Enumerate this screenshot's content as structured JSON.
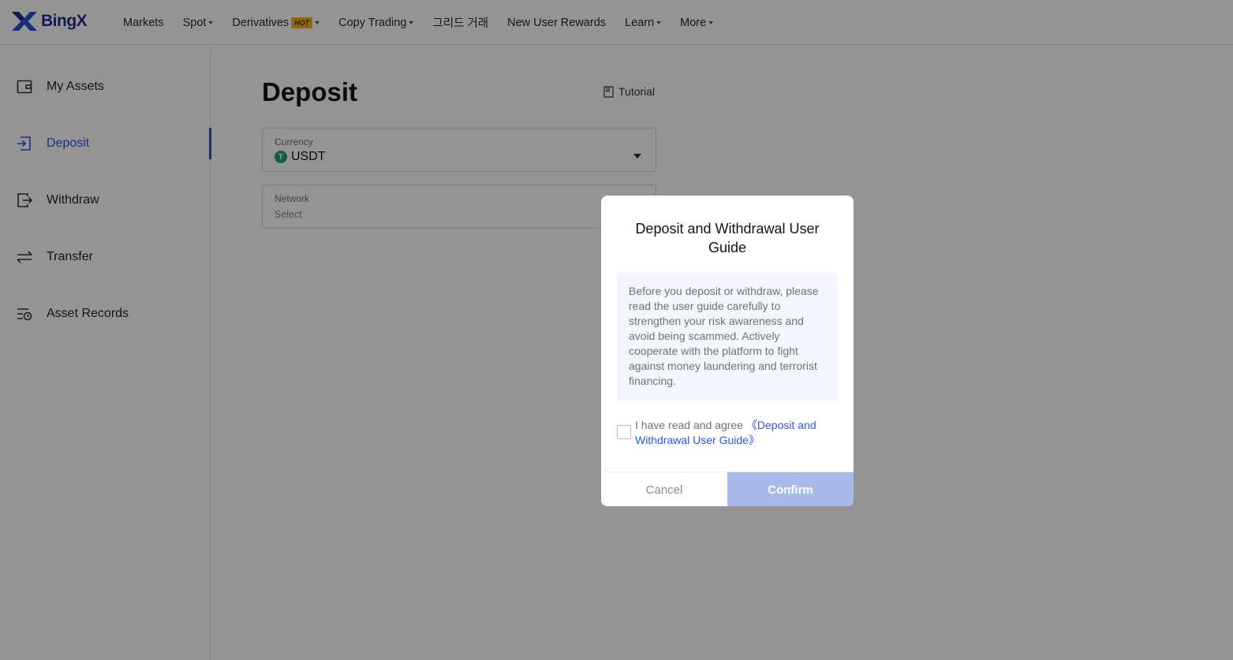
{
  "brand": {
    "name": "BingX",
    "color": "#1e2e8c",
    "icon": "bingx-logo-icon"
  },
  "nav": {
    "markets": "Markets",
    "spot": "Spot",
    "derivatives": "Derivatives",
    "hot_badge": "HOT",
    "copy_trading": "Copy Trading",
    "grid_trading": "그리드 거래",
    "new_user_rewards": "New User Rewards",
    "learn": "Learn",
    "more": "More"
  },
  "sidebar": {
    "items": [
      {
        "label": "My Assets",
        "icon": "wallet-icon"
      },
      {
        "label": "Deposit",
        "icon": "deposit-icon",
        "active": true
      },
      {
        "label": "Withdraw",
        "icon": "withdraw-icon"
      },
      {
        "label": "Transfer",
        "icon": "transfer-icon"
      },
      {
        "label": "Asset Records",
        "icon": "records-icon"
      }
    ],
    "active_color": "#2a55e5"
  },
  "main": {
    "title": "Deposit",
    "tutorial": "Tutorial",
    "currency": {
      "label": "Currency",
      "value": "USDT",
      "icon_glyph": "T"
    },
    "network": {
      "label": "Network",
      "placeholder": "Select"
    }
  },
  "modal": {
    "title": "Deposit and Withdrawal User Guide",
    "body": "Before you deposit or withdraw, please read the user guide carefully to strengthen your risk awareness and avoid being scammed. Actively cooperate with the platform to fight against money laundering and terrorist financing.",
    "agree_prefix": "I have read and agree ",
    "agree_link": "《Deposit and Withdrawal User Guide》",
    "cancel": "Cancel",
    "confirm": "Confirm",
    "confirm_color": "#a9b9ea"
  }
}
